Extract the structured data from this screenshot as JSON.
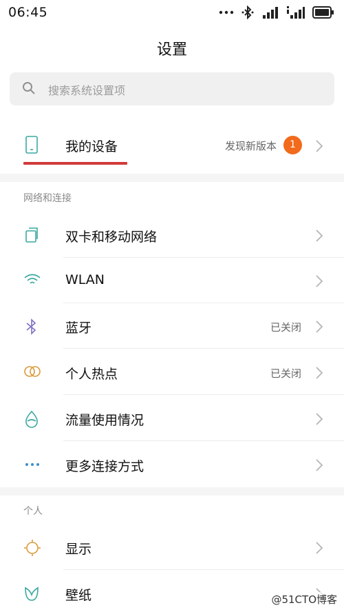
{
  "status_bar": {
    "time": "06:45"
  },
  "header": {
    "title": "设置"
  },
  "search": {
    "placeholder": "搜索系统设置项"
  },
  "device": {
    "label": "我的设备",
    "update_text": "发现新版本",
    "badge_count": "1"
  },
  "network_group": {
    "header": "网络和连接",
    "items": [
      {
        "label": "双卡和移动网络",
        "status": "",
        "icon": "sim-card-icon"
      },
      {
        "label": "WLAN",
        "status": "",
        "icon": "wifi-icon"
      },
      {
        "label": "蓝牙",
        "status": "已关闭",
        "icon": "bluetooth-icon"
      },
      {
        "label": "个人热点",
        "status": "已关闭",
        "icon": "hotspot-icon"
      },
      {
        "label": "流量使用情况",
        "status": "",
        "icon": "data-usage-icon"
      },
      {
        "label": "更多连接方式",
        "status": "",
        "icon": "more-icon"
      }
    ]
  },
  "personal_group": {
    "header": "个人",
    "items": [
      {
        "label": "显示",
        "status": "",
        "icon": "display-icon"
      },
      {
        "label": "壁纸",
        "status": "",
        "icon": "wallpaper-icon"
      }
    ]
  },
  "watermark": "@51CTO博客",
  "colors": {
    "accent_underline": "#d23a3a",
    "badge": "#f26a1b",
    "icon_teal": "#3aa8a0"
  }
}
